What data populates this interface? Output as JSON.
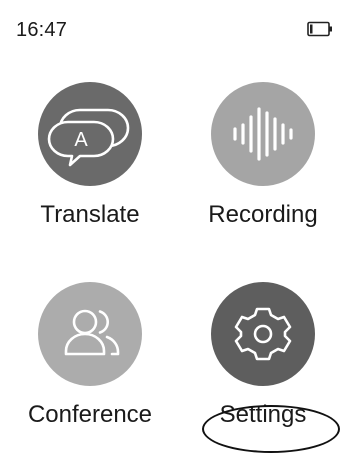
{
  "status_bar": {
    "time": "16:47",
    "battery_icon": "battery-low-icon"
  },
  "apps": [
    {
      "id": "translate",
      "label": "Translate",
      "icon": "translate-speech-bubbles-icon",
      "color": "#6a6a6a"
    },
    {
      "id": "recording",
      "label": "Recording",
      "icon": "sound-wave-icon",
      "color": "#a5a5a5"
    },
    {
      "id": "conference",
      "label": "Conference",
      "icon": "people-icon",
      "color": "#acacac"
    },
    {
      "id": "settings",
      "label": "Settings",
      "icon": "gear-icon",
      "color": "#5e5e5e"
    }
  ],
  "translate_icon_letter": "A",
  "annotation": {
    "highlighted_app": "Settings",
    "ellipse_color": "#111111"
  }
}
